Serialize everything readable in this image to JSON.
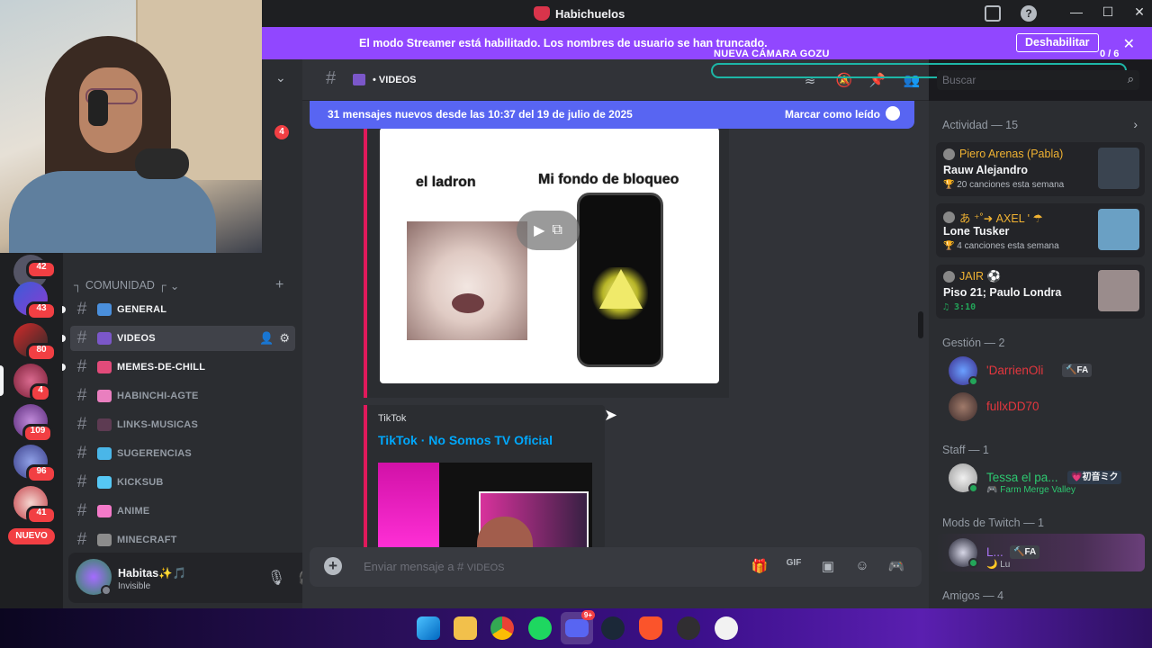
{
  "titlebar": {
    "title": "Habichuelos"
  },
  "streamer_banner": {
    "message": "El modo Streamer está habilitado. Los nombres de usuario se han truncado.",
    "button": "Deshabilitar",
    "close": "✕"
  },
  "camera_overlay": {
    "label": "NUEVA CÁMARA GOZU",
    "count": "0 / 6"
  },
  "servers": [
    {
      "badge": "42"
    },
    {
      "badge": "43"
    },
    {
      "badge": "80"
    },
    {
      "badge": "4"
    },
    {
      "badge": "109"
    },
    {
      "badge": "96"
    },
    {
      "badge": "41"
    }
  ],
  "servers_new": "NUEVO",
  "sidebar": {
    "unread_badge": "4",
    "category": "COMUNIDAD",
    "category_prefix": "┐",
    "category_suffix": "┌",
    "channels": [
      {
        "name": "GENERAL",
        "emoji_color": "#4a8fdc",
        "unread": true
      },
      {
        "name": "VIDEOS",
        "emoji_color": "#7b57c9",
        "unread": true,
        "active": true
      },
      {
        "name": "MEMES-DE-CHILL",
        "emoji_color": "#e24b7a",
        "unread": true
      },
      {
        "name": "HABINCHI-AGTE",
        "emoji_color": "#e97fbf",
        "unread": false
      },
      {
        "name": "LINKS-MUSICAS",
        "emoji_color": "#5d3b52",
        "unread": false
      },
      {
        "name": "SUGERENCIAS",
        "emoji_color": "#4ab6e8",
        "unread": false
      },
      {
        "name": "KICKSUB",
        "emoji_color": "#56c8f5",
        "unread": false
      },
      {
        "name": "ANIME",
        "emoji_color": "#f47ac9",
        "unread": false
      },
      {
        "name": "MINECRAFT",
        "emoji_color": "#8c8c8c",
        "unread": false
      }
    ]
  },
  "user_panel": {
    "name": "Habitas✨🎵",
    "status": "Invisible"
  },
  "chat_header": {
    "channel": "VIDEOS",
    "bullet": "•"
  },
  "search": {
    "placeholder": "Buscar"
  },
  "new_messages_bar": {
    "text": "31 mensajes nuevos desde las 10:37 del 19 de julio de 2025",
    "action": "Marcar como leído"
  },
  "meme": {
    "left_caption": "el ladron",
    "right_caption": "Mi fondo de bloqueo"
  },
  "tiktok_embed": {
    "provider": "TikTok",
    "title": "TikTok · No Somos TV Oficial"
  },
  "composer": {
    "placeholder_prefix": "Enviar mensaje a #",
    "placeholder_channel": "VIDEOS"
  },
  "members": {
    "activity_title": "Actividad — 15",
    "activity": [
      {
        "user": "Piero Arenas (Pabla)",
        "song": "Rauw Alejandro",
        "sub": "🏆 20 canciones esta semana",
        "cover_color": "#3a4450"
      },
      {
        "user": "あ ⁺˚➜ AXEL ' ☂",
        "song": "Lone Tusker",
        "sub": "🏆 4 canciones esta semana",
        "cover_color": "#6aa0c4"
      },
      {
        "user": "JAIR ⚽",
        "song": "Piso 21; Paulo Londra",
        "sub": "♫ 3:10",
        "cover_color": "#9a8c8c"
      }
    ],
    "groups": [
      {
        "title": "Gestión — 2"
      },
      {
        "title": "Staff — 1"
      },
      {
        "title": "Mods de Twitch — 1"
      },
      {
        "title": "Amigos — 4"
      }
    ],
    "gestion": [
      {
        "name": "'DarrienOli",
        "tag": "🔨FA",
        "color": "#e4373e"
      },
      {
        "name": "fullxDD70",
        "color": "#e4373e"
      }
    ],
    "staff": [
      {
        "name": "Tessa el pa...",
        "tag": "💗初音ミク",
        "activity": "🎮 Farm Merge Valley",
        "color": "#2dc770"
      }
    ],
    "mods": [
      {
        "name": "L...",
        "tag": "🔨FA",
        "activity": "🌙 Lu",
        "color": "#a974f5"
      }
    ]
  },
  "icons": {
    "taskbar": [
      "windows-icon",
      "file-explorer-icon",
      "chrome-icon",
      "spotify-icon",
      "discord-icon",
      "steam-icon",
      "brave-icon",
      "obs-icon",
      "lens-icon"
    ]
  },
  "colors": {
    "streamer_purple": "#9147ff",
    "blurple": "#5865f2",
    "embed_pink": "#e0195b",
    "link_blue": "#00a8fc"
  },
  "discord_badge": "9+"
}
